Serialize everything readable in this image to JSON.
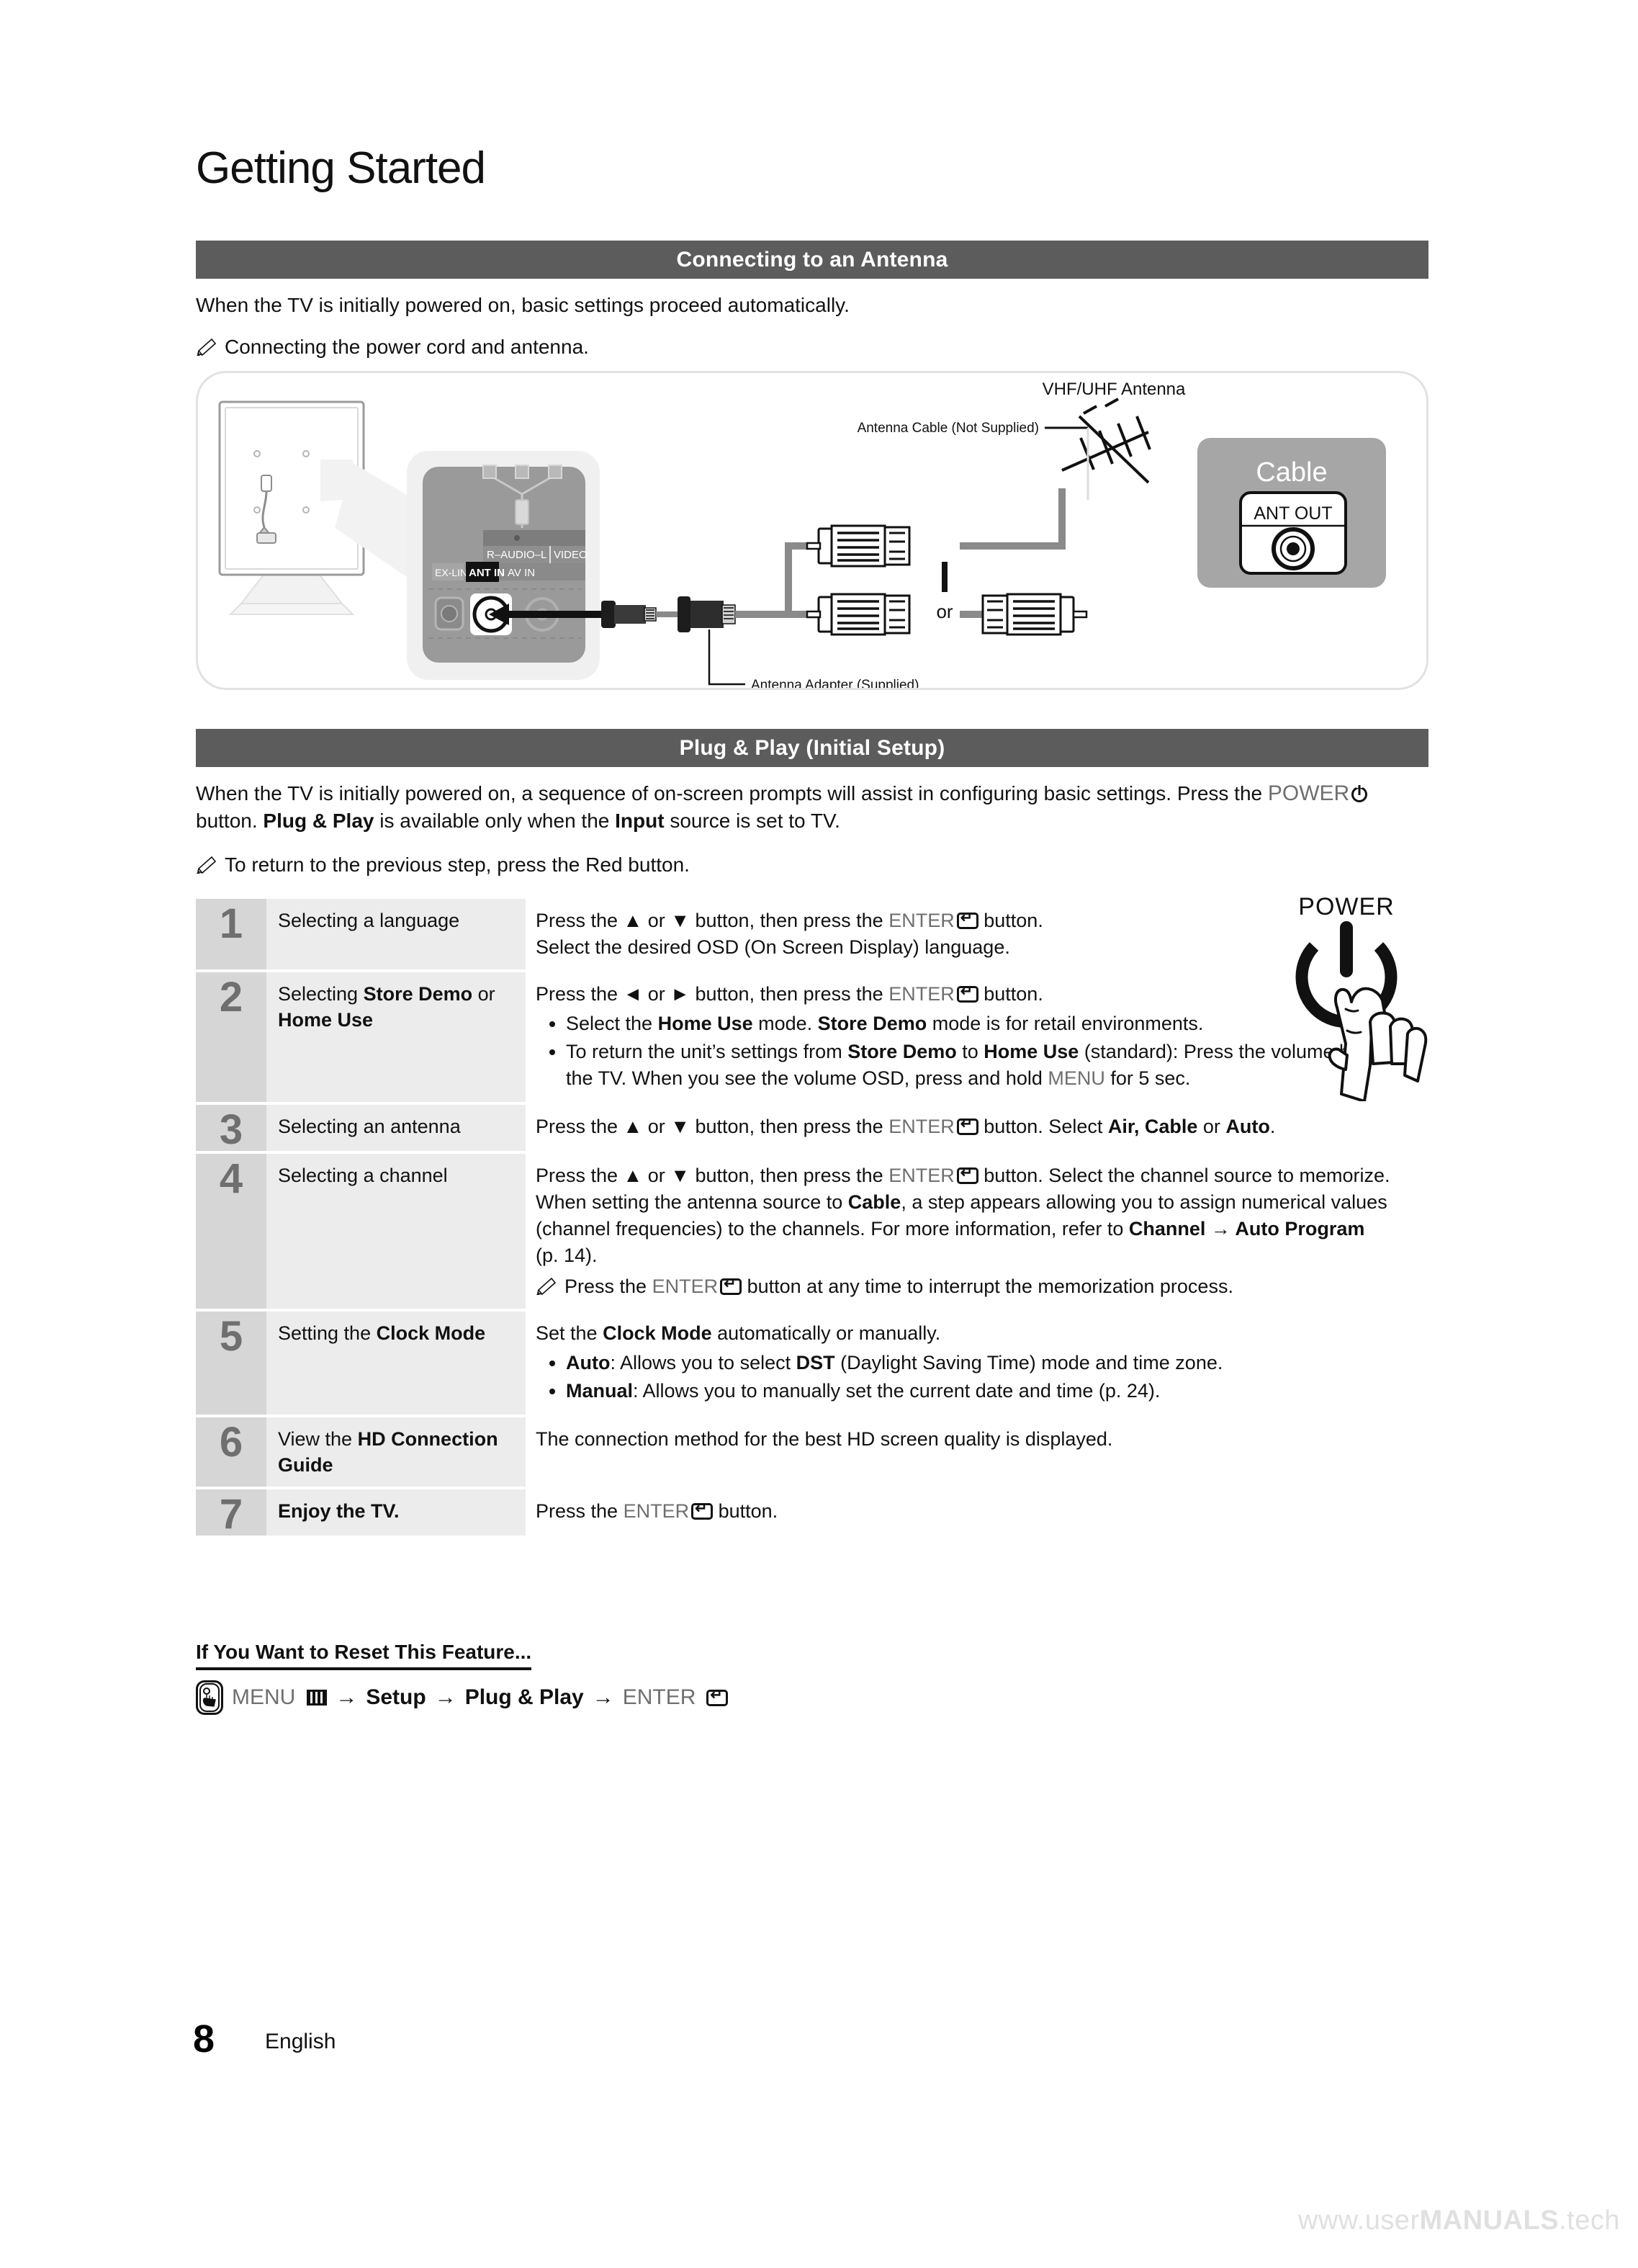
{
  "page": {
    "title": "Getting Started",
    "number": "8",
    "language": "English",
    "watermark_prefix": "www.user",
    "watermark_bold": "MANUALS",
    "watermark_suffix": ".tech"
  },
  "sections": {
    "antenna": {
      "bar_title": "Connecting to an Antenna",
      "intro": "When the TV is initially powered on, basic settings proceed automatically.",
      "note": "Connecting the power cord and antenna."
    },
    "plug_play": {
      "bar_title": "Plug & Play (Initial Setup)",
      "intro_1": "When the TV is initially powered on, a sequence of on-screen prompts will assist in configuring basic settings. Press the",
      "intro_power": "POWER",
      "intro_2": "button.",
      "intro_bold_1": "Plug & Play",
      "intro_3": "is available only when the",
      "intro_bold_2": "Input",
      "intro_4": "source is set to TV.",
      "note": "To return to the previous step, press the Red button."
    }
  },
  "diagram": {
    "antenna_label": "VHF/UHF Antenna",
    "antenna_cable_label": "Antenna Cable (Not Supplied)",
    "antenna_adapter_label": "Antenna Adapter (Supplied)",
    "or_label": "or",
    "cable_box_title": "Cable",
    "cable_box_port": "ANT OUT",
    "panel_ports": {
      "ex_link": "EX-LINK",
      "ant_in": "ANT IN",
      "audio": "R–AUDIO–L",
      "video": "VIDEO",
      "av_in": "AV IN"
    }
  },
  "power_illustration": {
    "label": "POWER"
  },
  "steps": [
    {
      "num": "1",
      "label_plain_1": "Selecting a language",
      "label_bold": "",
      "label_plain_2": "",
      "desc_line_1_a": "Press the ▲ or ▼ button, then press the",
      "desc_line_1_enter": "ENTER",
      "desc_line_1_b": "button.",
      "desc_line_2": "Select the desired OSD (On Screen Display) language.",
      "bullets": []
    },
    {
      "num": "2",
      "label_plain_1": "Selecting ",
      "label_bold": "Store Demo",
      "label_plain_2": " or ",
      "label_bold_2": "Home Use",
      "desc_line_1_a": "Press the ◄ or ► button, then press the",
      "desc_line_1_enter": "ENTER",
      "desc_line_1_b": "button.",
      "bullets": [
        "Select the Home Use mode. Store Demo mode is for retail environments.",
        "To return the unit’s settings from Store Demo to Home Use (standard): Press the volume button on the TV. When you see the volume OSD, press and hold MENU for 5 sec."
      ]
    },
    {
      "num": "3",
      "label_plain_1": "Selecting an antenna",
      "desc_line_1_a": "Press the ▲ or ▼ button, then press the",
      "desc_line_1_enter": "ENTER",
      "desc_line_1_b": "button. Select Air, Cable or Auto."
    },
    {
      "num": "4",
      "label_plain_1": "Selecting a channel",
      "desc_line_1_a": "Press the ▲ or ▼ button, then press the",
      "desc_line_1_enter": "ENTER",
      "desc_line_1_b": "button. Select the channel source to memorize. When setting the antenna source to Cable, a step appears allowing you to assign numerical values (channel frequencies) to the channels. For more information, refer to Channel → Auto Program (p. 14).",
      "subnote_a": "Press the",
      "subnote_enter": "ENTER",
      "subnote_b": "button at any time to interrupt the memorization process."
    },
    {
      "num": "5",
      "label_plain_1": "Setting the ",
      "label_bold": "Clock Mode",
      "desc_line_1": "Set the Clock Mode automatically or manually.",
      "bullets": [
        "Auto: Allows you to select DST (Daylight Saving Time) mode and time zone.",
        "Manual: Allows you to manually set the current date and time (p. 24)."
      ]
    },
    {
      "num": "6",
      "label_plain_1": "View the ",
      "label_bold": "HD Connection Guide",
      "desc_line_1": "The connection method for the best HD screen quality is displayed."
    },
    {
      "num": "7",
      "label_bold": "Enjoy the TV.",
      "desc_line_1_a": "Press the",
      "desc_line_1_enter": "ENTER",
      "desc_line_1_b": "button."
    }
  ],
  "reset": {
    "heading": "If You Want to Reset This Feature...",
    "path_menu": "MENU",
    "arrow": "→",
    "path_setup": "Setup",
    "path_plugplay": "Plug & Play",
    "path_enter": "ENTER"
  },
  "colors": {
    "bar_bg": "#5c5c5c",
    "num_cell_bg": "#d6d6d6",
    "label_cell_bg": "#ececec",
    "num_text": "#6f6f6f",
    "watermark": "#e0e0e0"
  }
}
